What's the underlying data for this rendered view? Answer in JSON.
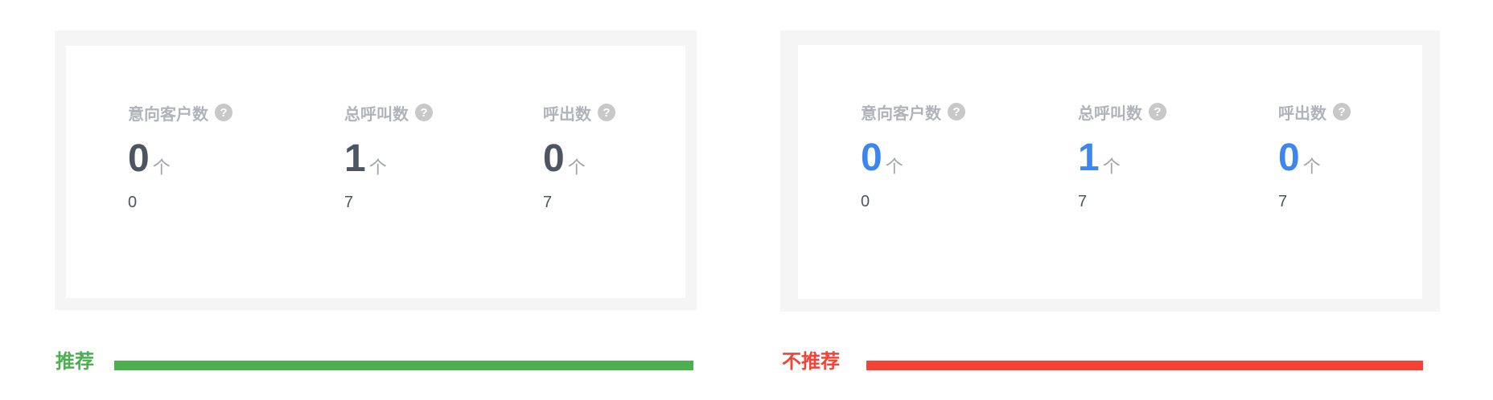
{
  "panels": [
    {
      "id": "recommended",
      "value_color": "#4d5562",
      "stats": [
        {
          "label": "意向客户数",
          "value": "0",
          "unit": "个",
          "sub": "0"
        },
        {
          "label": "总呼叫数",
          "value": "1",
          "unit": "个",
          "sub": "7"
        },
        {
          "label": "呼出数",
          "value": "0",
          "unit": "个",
          "sub": "7"
        }
      ],
      "caption": {
        "text": "推荐",
        "color": "#4caf50"
      }
    },
    {
      "id": "not-recommended",
      "value_color": "#3d86f0",
      "stats": [
        {
          "label": "意向客户数",
          "value": "0",
          "unit": "个",
          "sub": "0"
        },
        {
          "label": "总呼叫数",
          "value": "1",
          "unit": "个",
          "sub": "7"
        },
        {
          "label": "呼出数",
          "value": "0",
          "unit": "个",
          "sub": "7"
        }
      ],
      "caption": {
        "text": "不推荐",
        "color": "#f44336"
      }
    }
  ],
  "icons": {
    "help": "?"
  }
}
